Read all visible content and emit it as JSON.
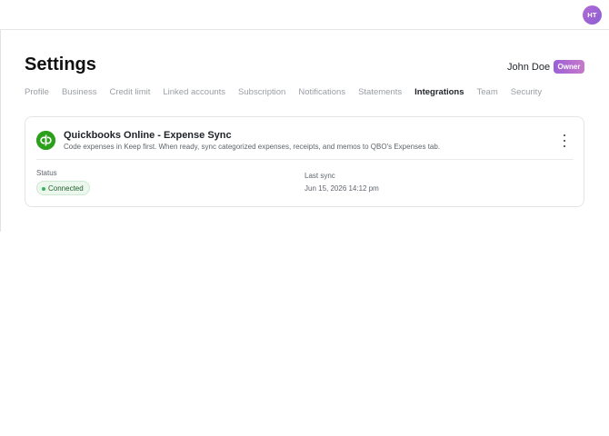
{
  "header": {
    "avatar_initials": "HT"
  },
  "page": {
    "title": "Settings",
    "user_name": "John Doe",
    "role_badge": "Owner"
  },
  "tabs": [
    {
      "label": "Profile"
    },
    {
      "label": "Business"
    },
    {
      "label": "Credit limit"
    },
    {
      "label": "Linked accounts"
    },
    {
      "label": "Subscription"
    },
    {
      "label": "Notifications"
    },
    {
      "label": "Statements"
    },
    {
      "label": "Integrations",
      "active": true
    },
    {
      "label": "Team"
    },
    {
      "label": "Security"
    }
  ],
  "integration": {
    "logo_icon": "quickbooks-logo-icon",
    "title": "Quickbooks Online - Expense Sync",
    "description": "Code expenses in Keep first. When ready, sync categorized expenses, receipts, and memos to QBO's Expenses tab.",
    "status_label": "Status",
    "status_value": "Connected",
    "last_sync_label": "Last sync",
    "last_sync_value": "Jun 15, 2026 14:12 pm"
  },
  "colors": {
    "brand_gradient_start": "#9b5fd6",
    "brand_gradient_end": "#c77ac9",
    "quickbooks_green": "#2ca01c",
    "connected_green": "#38b25a"
  }
}
